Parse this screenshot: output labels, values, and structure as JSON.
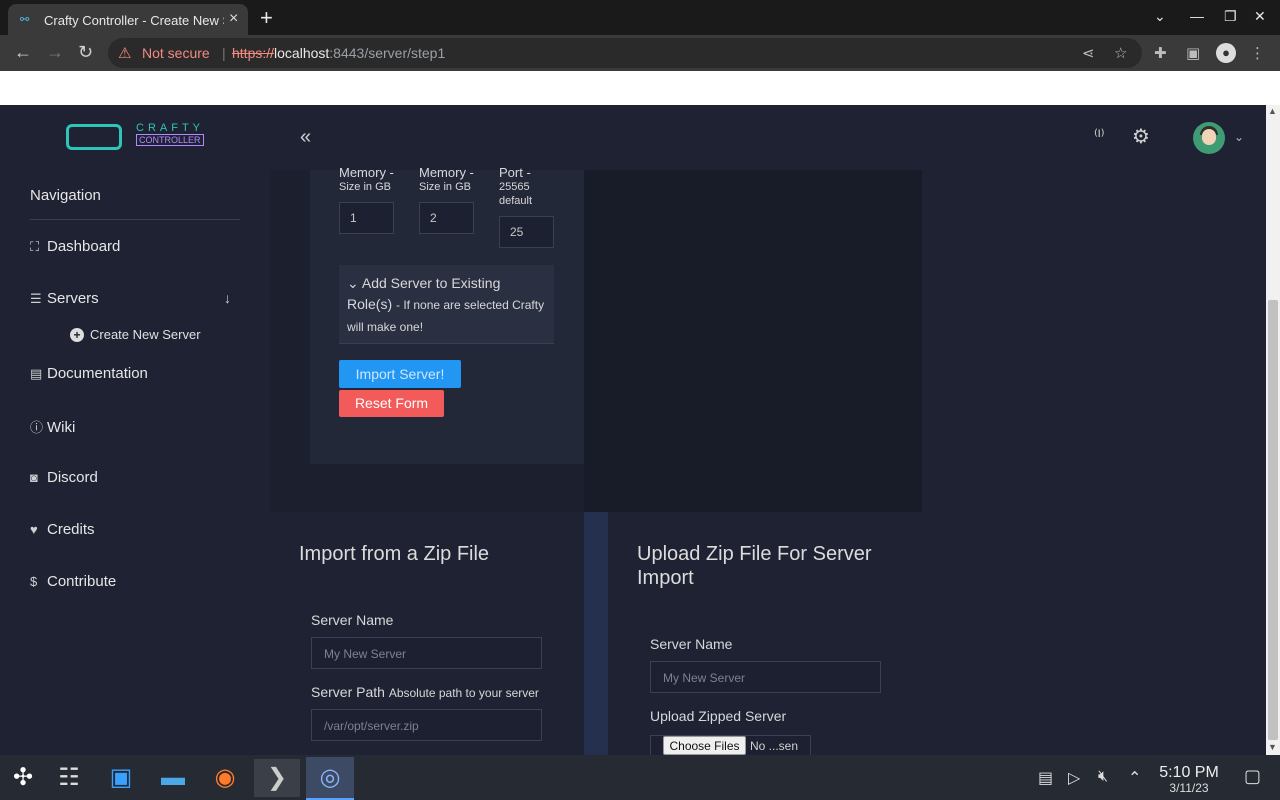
{
  "browser": {
    "tab_title": "Crafty Controller - Create New Server",
    "tab_icon": "link-icon",
    "security_text": "Not secure",
    "url_scheme": "https://",
    "url_host": "localhost",
    "url_rest": ":8443/server/step1"
  },
  "logo": {
    "line1": "CRAFTY",
    "line2": "CONTROLLER"
  },
  "sidebar": {
    "heading": "Navigation",
    "items": [
      {
        "label": "Dashboard",
        "icon": "sitemap-icon"
      },
      {
        "label": "Servers",
        "icon": "server-icon"
      },
      {
        "label": "Documentation",
        "icon": "book-icon"
      },
      {
        "label": "Wiki",
        "icon": "info-icon"
      },
      {
        "label": "Discord",
        "icon": "discord-icon"
      },
      {
        "label": "Credits",
        "icon": "heart-icon"
      },
      {
        "label": "Contribute",
        "icon": "donate-icon"
      }
    ],
    "sub_item": "Create New Server"
  },
  "form_upper": {
    "min_mem_label": "Memory -",
    "min_mem_sub": "Size in GB",
    "min_mem_value": "1",
    "max_mem_label": "Memory -",
    "max_mem_sub": "Size in GB",
    "max_mem_value": "2",
    "port_label": "Port -",
    "port_sub1": "25565",
    "port_sub2": "default",
    "port_value": "25",
    "roles_title": "Add Server to Existing",
    "roles_title2": "Role(s)",
    "roles_hint": "- If none are selected Crafty will make one!",
    "import_button": "Import Server!",
    "reset_button": "Reset Form"
  },
  "zip_import": {
    "heading": "Import from a Zip File",
    "name_label": "Server Name",
    "name_placeholder": "My New Server",
    "path_label": "Server Path",
    "path_hint": "Absolute path to your server",
    "path_placeholder": "/var/opt/server.zip"
  },
  "zip_upload": {
    "heading": "Upload Zip File For Server Import",
    "name_label": "Server Name",
    "name_placeholder": "My New Server",
    "upload_label": "Upload Zipped Server",
    "choose_button": "Choose Files",
    "no_file_text": "No ...sen"
  },
  "taskbar": {
    "time": "5:10 PM",
    "date": "3/11/23"
  },
  "colors": {
    "accent": "#2196f3",
    "danger": "#f35a5a",
    "background": "#1e2233"
  }
}
